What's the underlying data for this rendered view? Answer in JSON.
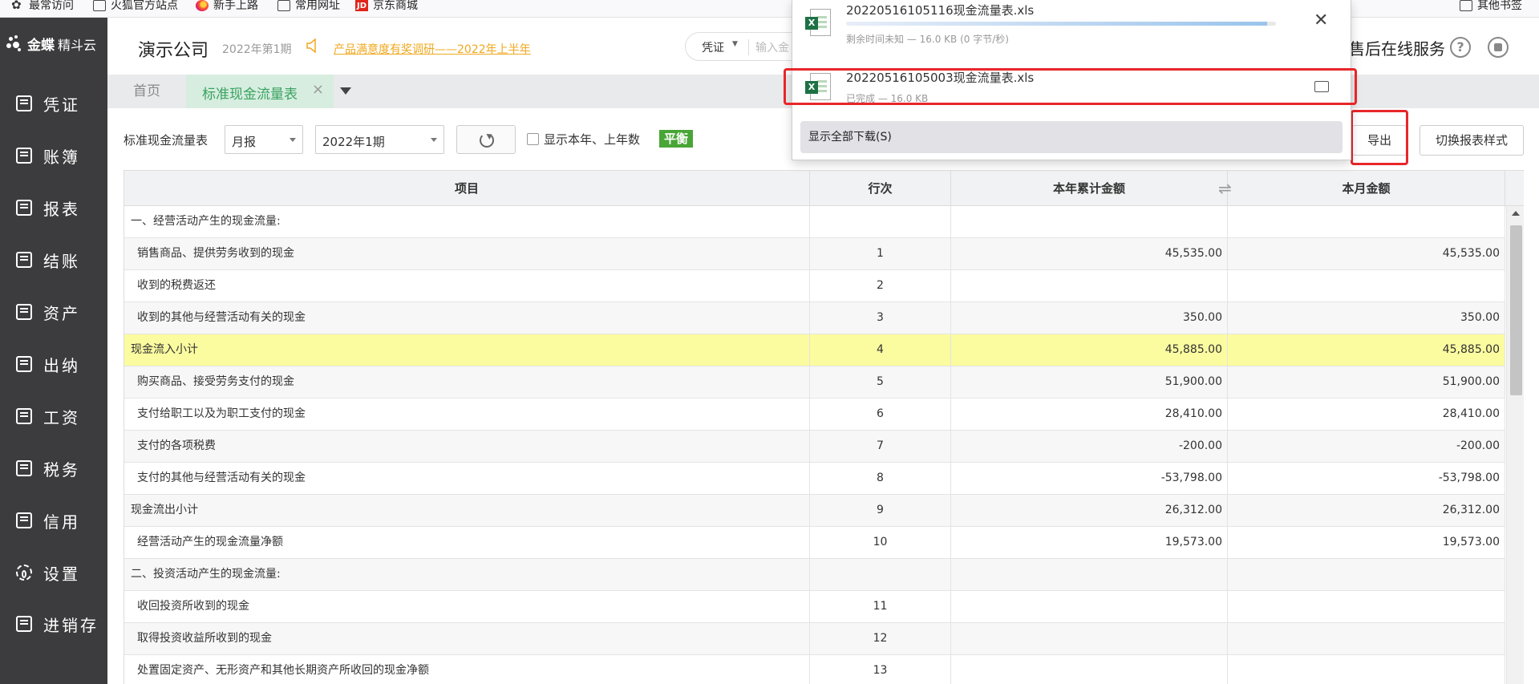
{
  "bookmarks": [
    {
      "label": "最常访问",
      "icon": "gear-icon"
    },
    {
      "label": "火狐官方站点",
      "icon": "folder-icon"
    },
    {
      "label": "新手上路",
      "icon": "firefox-icon"
    },
    {
      "label": "常用网址",
      "icon": "folder-icon"
    },
    {
      "label": "京东商城",
      "icon": "jd-icon",
      "icon_text": "JD"
    },
    {
      "label": "其他书签",
      "icon": "folder-icon"
    }
  ],
  "app": {
    "logo_brand": "金蝶",
    "logo_product": "精斗云",
    "company": "演示公司",
    "period": "2022年第1期",
    "survey_link": "产品满意度有奖调研——2022年上半年",
    "search_type": "凭证",
    "search_placeholder": "输入金",
    "after_sales": "售后在线服务",
    "help_icon_text": "?"
  },
  "sidebar": {
    "items": [
      {
        "label": "凭证",
        "icon": "voucher-icon"
      },
      {
        "label": "账簿",
        "icon": "ledger-icon"
      },
      {
        "label": "报表",
        "icon": "report-icon"
      },
      {
        "label": "结账",
        "icon": "checkout-icon"
      },
      {
        "label": "资产",
        "icon": "asset-icon"
      },
      {
        "label": "出纳",
        "icon": "cashier-icon"
      },
      {
        "label": "工资",
        "icon": "salary-icon"
      },
      {
        "label": "税务",
        "icon": "tax-icon"
      },
      {
        "label": "信用",
        "icon": "credit-icon"
      },
      {
        "label": "设置",
        "icon": "gear-icon"
      },
      {
        "label": "进销存",
        "icon": "inventory-icon"
      }
    ]
  },
  "tabs": {
    "home": "首页",
    "active": "标准现金流量表",
    "close": "×"
  },
  "toolbar": {
    "report_label": "标准现金流量表",
    "period_type": "月报",
    "period": "2022年1期",
    "show_years_label": "显示本年、上年数",
    "balance_badge": "平衡",
    "export": "导出",
    "switch_style": "切换报表样式"
  },
  "table": {
    "headers": {
      "item": "项目",
      "line": "行次",
      "year": "本年累计金额",
      "month": "本月金额"
    },
    "rows": [
      {
        "item": "一、经营活动产生的现金流量:",
        "line": "",
        "year": "",
        "month": "",
        "indent": false
      },
      {
        "item": "销售商品、提供劳务收到的现金",
        "line": "1",
        "year": "45,535.00",
        "month": "45,535.00",
        "indent": true
      },
      {
        "item": "收到的税费返还",
        "line": "2",
        "year": "",
        "month": "",
        "indent": true
      },
      {
        "item": "收到的其他与经营活动有关的现金",
        "line": "3",
        "year": "350.00",
        "month": "350.00",
        "indent": true
      },
      {
        "item": "现金流入小计",
        "line": "4",
        "year": "45,885.00",
        "month": "45,885.00",
        "indent": false,
        "highlight": true
      },
      {
        "item": "购买商品、接受劳务支付的现金",
        "line": "5",
        "year": "51,900.00",
        "month": "51,900.00",
        "indent": true
      },
      {
        "item": "支付给职工以及为职工支付的现金",
        "line": "6",
        "year": "28,410.00",
        "month": "28,410.00",
        "indent": true
      },
      {
        "item": "支付的各项税费",
        "line": "7",
        "year": "-200.00",
        "month": "-200.00",
        "indent": true
      },
      {
        "item": "支付的其他与经营活动有关的现金",
        "line": "8",
        "year": "-53,798.00",
        "month": "-53,798.00",
        "indent": true
      },
      {
        "item": "现金流出小计",
        "line": "9",
        "year": "26,312.00",
        "month": "26,312.00",
        "indent": false
      },
      {
        "item": "经营活动产生的现金流量净额",
        "line": "10",
        "year": "19,573.00",
        "month": "19,573.00",
        "indent": true
      },
      {
        "item": "二、投资活动产生的现金流量:",
        "line": "",
        "year": "",
        "month": "",
        "indent": false
      },
      {
        "item": "收回投资所收到的现金",
        "line": "11",
        "year": "",
        "month": "",
        "indent": true
      },
      {
        "item": "取得投资收益所收到的现金",
        "line": "12",
        "year": "",
        "month": "",
        "indent": true
      },
      {
        "item": "处置固定资产、无形资产和其他长期资产所收回的现金净额",
        "line": "13",
        "year": "",
        "month": "",
        "indent": true
      }
    ]
  },
  "downloads": {
    "items": [
      {
        "filename": "20220516105116现金流量表.xls",
        "status": "剩余时间未知 — 16.0 KB (0 字节/秒)",
        "progress": 0.98
      },
      {
        "filename": "20220516105003现金流量表.xls",
        "status": "已完成 — 16.0 KB"
      }
    ],
    "cancel_glyph": "✕",
    "show_all": "显示全部下载(S)"
  },
  "colors": {
    "sidebar_bg": "#3c3c3e",
    "accent_green": "#3aa35f",
    "balance_green": "#49a536",
    "highlight_row": "#fbfba0",
    "survey_orange": "#f0a81f",
    "annotation_red": "#e8262a"
  }
}
